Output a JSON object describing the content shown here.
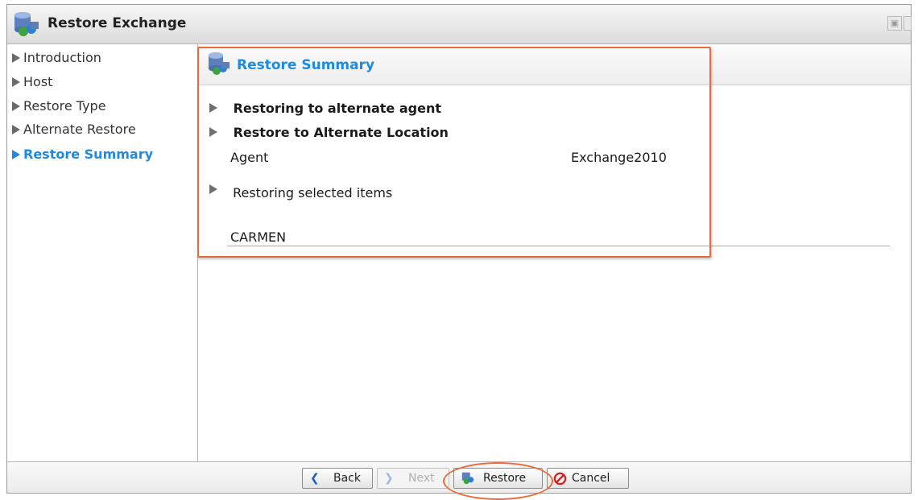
{
  "window": {
    "title": "Restore Exchange",
    "title_icon": "exchange-database-icon",
    "controls": [
      "maximize-icon",
      "close-icon"
    ]
  },
  "sidebar": {
    "items": [
      {
        "label": "Introduction",
        "active": false
      },
      {
        "label": "Host",
        "active": false
      },
      {
        "label": "Restore Type",
        "active": false
      },
      {
        "label": "Alternate Restore",
        "active": false
      },
      {
        "label": "Restore Summary",
        "active": true
      }
    ]
  },
  "summary": {
    "title": "Restore Summary",
    "icon": "exchange-database-icon",
    "section1": "Restoring to alternate agent",
    "section2": "Restore to Alternate Location",
    "agent_label": "Agent",
    "agent_value": "Exchange2010",
    "section3": "Restoring selected items",
    "selected_item": "CARMEN"
  },
  "footer": {
    "back_label": "Back",
    "next_label": "Next",
    "restore_label": "Restore",
    "cancel_label": "Cancel"
  },
  "colors": {
    "accent": "#1e8ae0",
    "highlight": "#ec6a3a"
  }
}
